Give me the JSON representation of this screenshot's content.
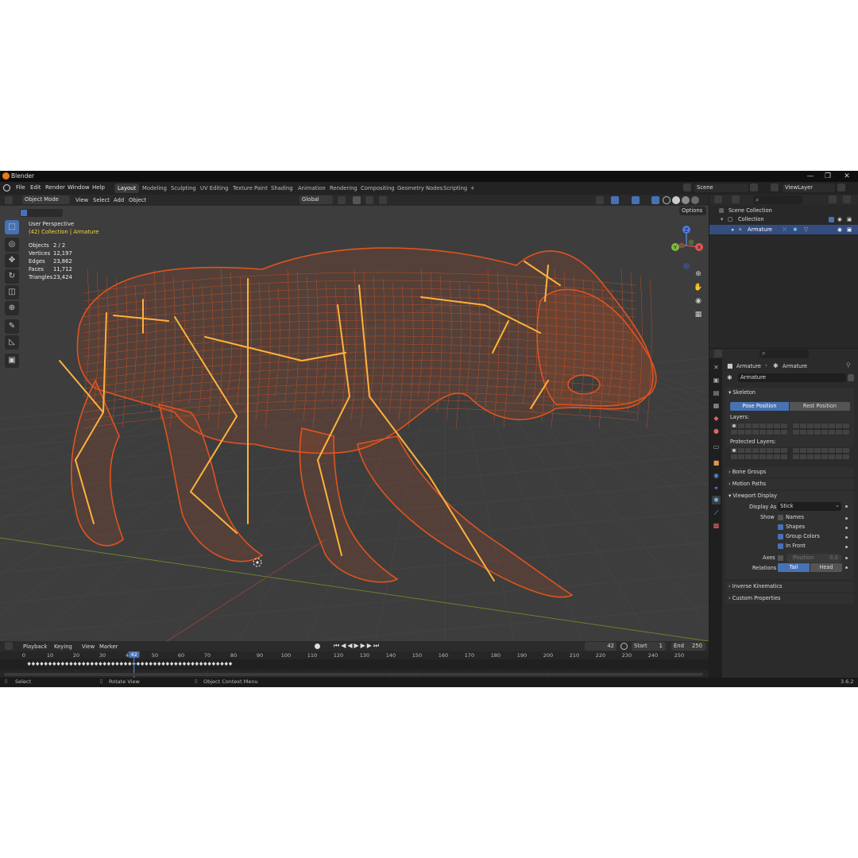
{
  "window": {
    "title": "Blender",
    "controls": [
      "—",
      "❐",
      "✕"
    ]
  },
  "menu": [
    "File",
    "Edit",
    "Render",
    "Window",
    "Help"
  ],
  "workspaces": [
    "Layout",
    "Modeling",
    "Sculpting",
    "UV Editing",
    "Texture Paint",
    "Shading",
    "Animation",
    "Rendering",
    "Compositing",
    "Geometry Nodes",
    "Scripting",
    "+"
  ],
  "active_workspace": "Layout",
  "scene": {
    "scene_name": "Scene",
    "view_layer": "ViewLayer"
  },
  "viewport_header": {
    "mode": "Object Mode",
    "view": "View",
    "select": "Select",
    "add": "Add",
    "object": "Object",
    "orientation": "Global",
    "options": "Options"
  },
  "viewport_overlay": {
    "perspective": "User Perspective",
    "collection": "(42) Collection | Armature"
  },
  "stats": [
    {
      "label": "Objects",
      "value": "2 / 2"
    },
    {
      "label": "Vertices",
      "value": "12,197"
    },
    {
      "label": "Edges",
      "value": "23,862"
    },
    {
      "label": "Faces",
      "value": "11,712"
    },
    {
      "label": "Triangles",
      "value": "23,424"
    }
  ],
  "gizmo": {
    "x": "X",
    "y": "Y",
    "z": "Z"
  },
  "outliner": {
    "scene_collection": "Scene Collection",
    "collection": "Collection",
    "armature": "Armature"
  },
  "properties": {
    "breadcrumb_object": "Armature",
    "breadcrumb_data": "Armature",
    "data_name": "Armature",
    "skeleton": {
      "header": "Skeleton",
      "pose_position": "Pose Position",
      "rest_position": "Rest Position",
      "layers": "Layers:",
      "protected_layers": "Protected Layers:"
    },
    "bone_groups": "Bone Groups",
    "motion_paths": "Motion Paths",
    "viewport_display": {
      "header": "Viewport Display",
      "display_as_label": "Display As",
      "display_as_value": "Stick",
      "show_label": "Show",
      "names": "Names",
      "shapes": "Shapes",
      "group_colors": "Group Colors",
      "in_front": "In Front",
      "axes_label": "Axes",
      "position_label": "Position",
      "position_value": "0.0",
      "relations_label": "Relations",
      "tail": "Tail",
      "head": "Head"
    },
    "checkboxes": {
      "names": false,
      "shapes": true,
      "group_colors": true,
      "in_front": true,
      "axes": false
    },
    "inverse_kinematics": "Inverse Kinematics",
    "custom_properties": "Custom Properties"
  },
  "timeline": {
    "playback": "Playback",
    "keying": "Keying",
    "view": "View",
    "marker": "Marker",
    "current_frame": "42",
    "start_label": "Start",
    "start": "1",
    "end_label": "End",
    "end": "250",
    "ruler": [
      "0",
      "10",
      "20",
      "30",
      "40",
      "50",
      "60",
      "70",
      "80",
      "90",
      "100",
      "110",
      "120",
      "130",
      "140",
      "150",
      "160",
      "170",
      "180",
      "190",
      "200",
      "210",
      "220",
      "230",
      "240",
      "250"
    ]
  },
  "statusbar": {
    "select": "Select",
    "rotate": "Rotate View",
    "context": "Object Context Menu",
    "version": "3.6.2"
  },
  "icons": [
    "blender-logo-icon",
    "select-box-icon",
    "cursor-icon",
    "move-icon",
    "rotate-icon",
    "scale-icon",
    "transform-icon",
    "annotate-icon",
    "measure-icon",
    "add-cube-icon",
    "zoom-icon",
    "hand-icon",
    "camera-icon",
    "grid-icon"
  ],
  "colors": {
    "accent": "#4772b3",
    "wireframe": "#e0531f",
    "bone": "#ffb23c",
    "object_text": "#ffd23a"
  }
}
